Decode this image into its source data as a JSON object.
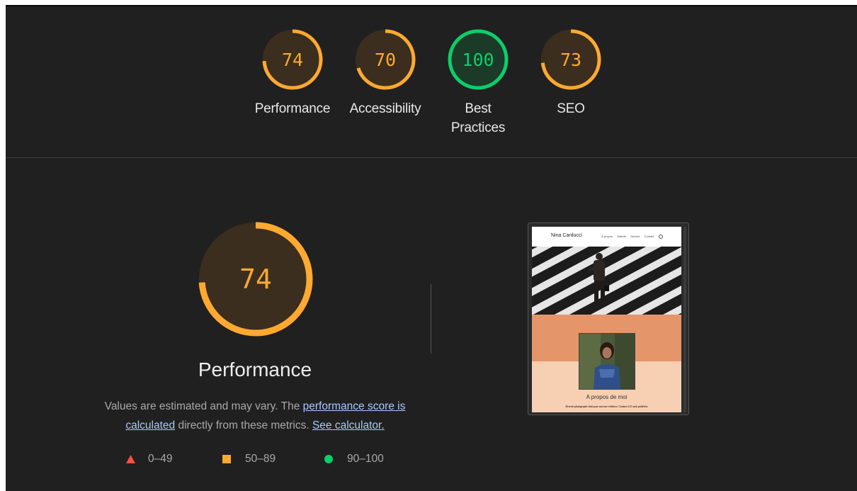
{
  "colors": {
    "background": "#202020",
    "average": "#ffa931",
    "average_bg": "#3b2e1f",
    "pass": "#0cce6b",
    "pass_bg": "#1b3a28",
    "fail": "#ff4e42",
    "text": "#eeeeee",
    "muted": "#a9a9a9",
    "link": "#a9c8ff"
  },
  "gauges": [
    {
      "label": "Performance",
      "score": 74,
      "rating": "average"
    },
    {
      "label": "Accessibility",
      "score": 70,
      "rating": "average"
    },
    {
      "label": "Best Practices",
      "score": 100,
      "rating": "pass"
    },
    {
      "label": "SEO",
      "score": 73,
      "rating": "average"
    }
  ],
  "performance": {
    "score": 74,
    "title": "Performance",
    "desc_before": "Values are estimated and may vary. The ",
    "score_link": "performance score is calculated",
    "desc_middle": " directly from these metrics. ",
    "calculator_link": "See calculator."
  },
  "legend": [
    {
      "range": "0–49",
      "icon": "triangle-icon",
      "color": "#ff4e42"
    },
    {
      "range": "50–89",
      "icon": "square-icon",
      "color": "#ffa931"
    },
    {
      "range": "90–100",
      "icon": "circle-icon",
      "color": "#0cce6b"
    }
  ],
  "screenshot": {
    "site_name": "Nina Carducci",
    "nav": [
      "À propos",
      "Galerie",
      "Service",
      "Contact"
    ],
    "about_title": "A propos de moi",
    "about_text": "Devenir photographe était pour moi une évidence. Contact à 15 mois préférées"
  }
}
